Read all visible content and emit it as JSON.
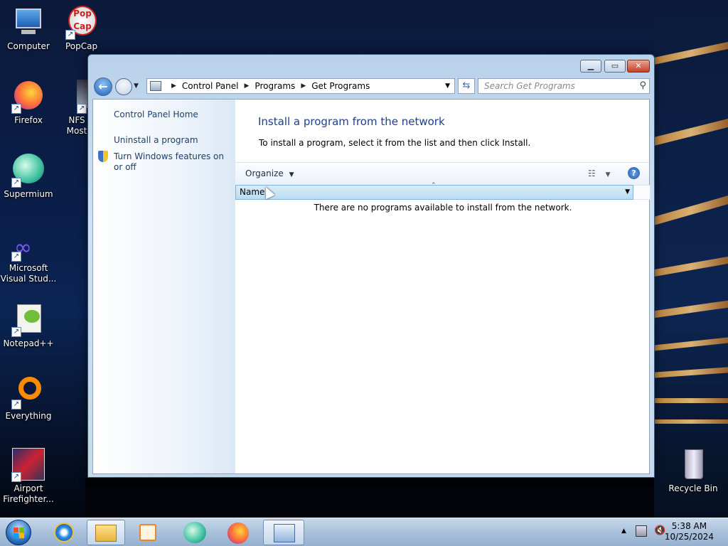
{
  "desktop": {
    "icons": [
      {
        "label": "Computer",
        "icon": "computer-icon"
      },
      {
        "label": "PopCap Game W...",
        "icon": "popcap-icon"
      },
      {
        "label": "Firefox",
        "icon": "firefox-icon"
      },
      {
        "label": "NFS Most Wanted",
        "icon": "nfs-icon"
      },
      {
        "label": "Supermium",
        "icon": "supermium-icon"
      },
      {
        "label": "Microsoft Visual Stud...",
        "icon": "visual-studio-icon"
      },
      {
        "label": "Notepad++",
        "icon": "notepadpp-icon"
      },
      {
        "label": "Everything",
        "icon": "everything-icon"
      },
      {
        "label": "Airport Firefighter...",
        "icon": "airport-firefighter-icon"
      },
      {
        "label": "Recycle Bin",
        "icon": "recycle-bin-icon"
      }
    ]
  },
  "window": {
    "controls": {
      "minimize": "▁",
      "maximize": "▭",
      "close": "✕"
    },
    "address": {
      "items": [
        "Control Panel",
        "Programs",
        "Get Programs"
      ]
    },
    "search": {
      "placeholder": "Search Get Programs"
    },
    "left_pane": {
      "home": "Control Panel Home",
      "uninstall": "Uninstall a program",
      "features": "Turn Windows features on or off"
    },
    "main": {
      "heading": "Install a program from the network",
      "instructions": "To install a program, select it from the list and then click Install.",
      "organize": "Organize",
      "column_name": "Name",
      "empty_message": "There are no programs available to install from the network."
    }
  },
  "taskbar": {
    "pinned": [
      "internet-explorer-icon",
      "explorer-icon",
      "media-player-icon",
      "supermium-icon",
      "firefox-icon",
      "control-panel-icon"
    ],
    "clock": {
      "time": "5:38 AM",
      "date": "10/25/2024"
    }
  }
}
